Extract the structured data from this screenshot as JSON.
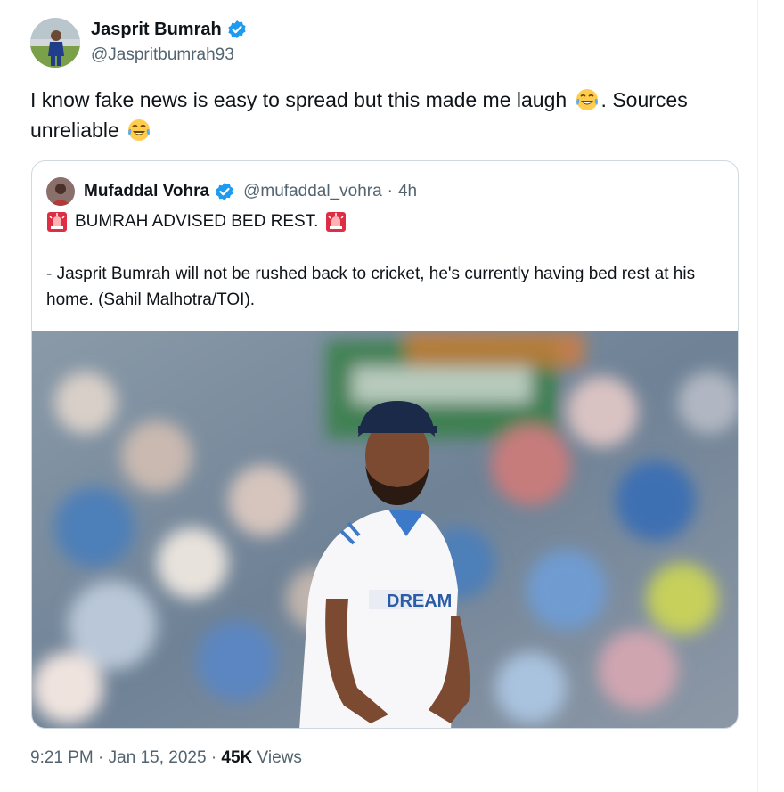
{
  "author": {
    "name": "Jasprit Bumrah",
    "handle": "@Jaspritbumrah93",
    "verified": true,
    "avatar_icon": "profile-photo"
  },
  "tweet": {
    "text_part1": "I know fake news is easy to spread but this made me laugh ",
    "text_part2": ".  Sources unreliable ",
    "emoji": "laughing-crying-emoji"
  },
  "quoted": {
    "name": "Mufaddal Vohra",
    "handle": "@mufaddal_vohra",
    "separator": "·",
    "time": "4h",
    "headline": "BUMRAH ADVISED BED REST.",
    "headline_icon": "police-siren-emoji",
    "body": "- Jasprit Bumrah will not be rushed back to cricket, he's currently having bed rest at his home. (Sahil Malhotra/TOI).",
    "photo_jersey_text": "DREAM"
  },
  "meta": {
    "time": "9:21 PM",
    "sep1": "·",
    "date": "Jan 15, 2025",
    "sep2": "·",
    "views_count": "45K",
    "views_label": " Views"
  },
  "colors": {
    "verified_blue": "#1d9bf0",
    "secondary_text": "#536471",
    "border": "#cfd9de"
  }
}
